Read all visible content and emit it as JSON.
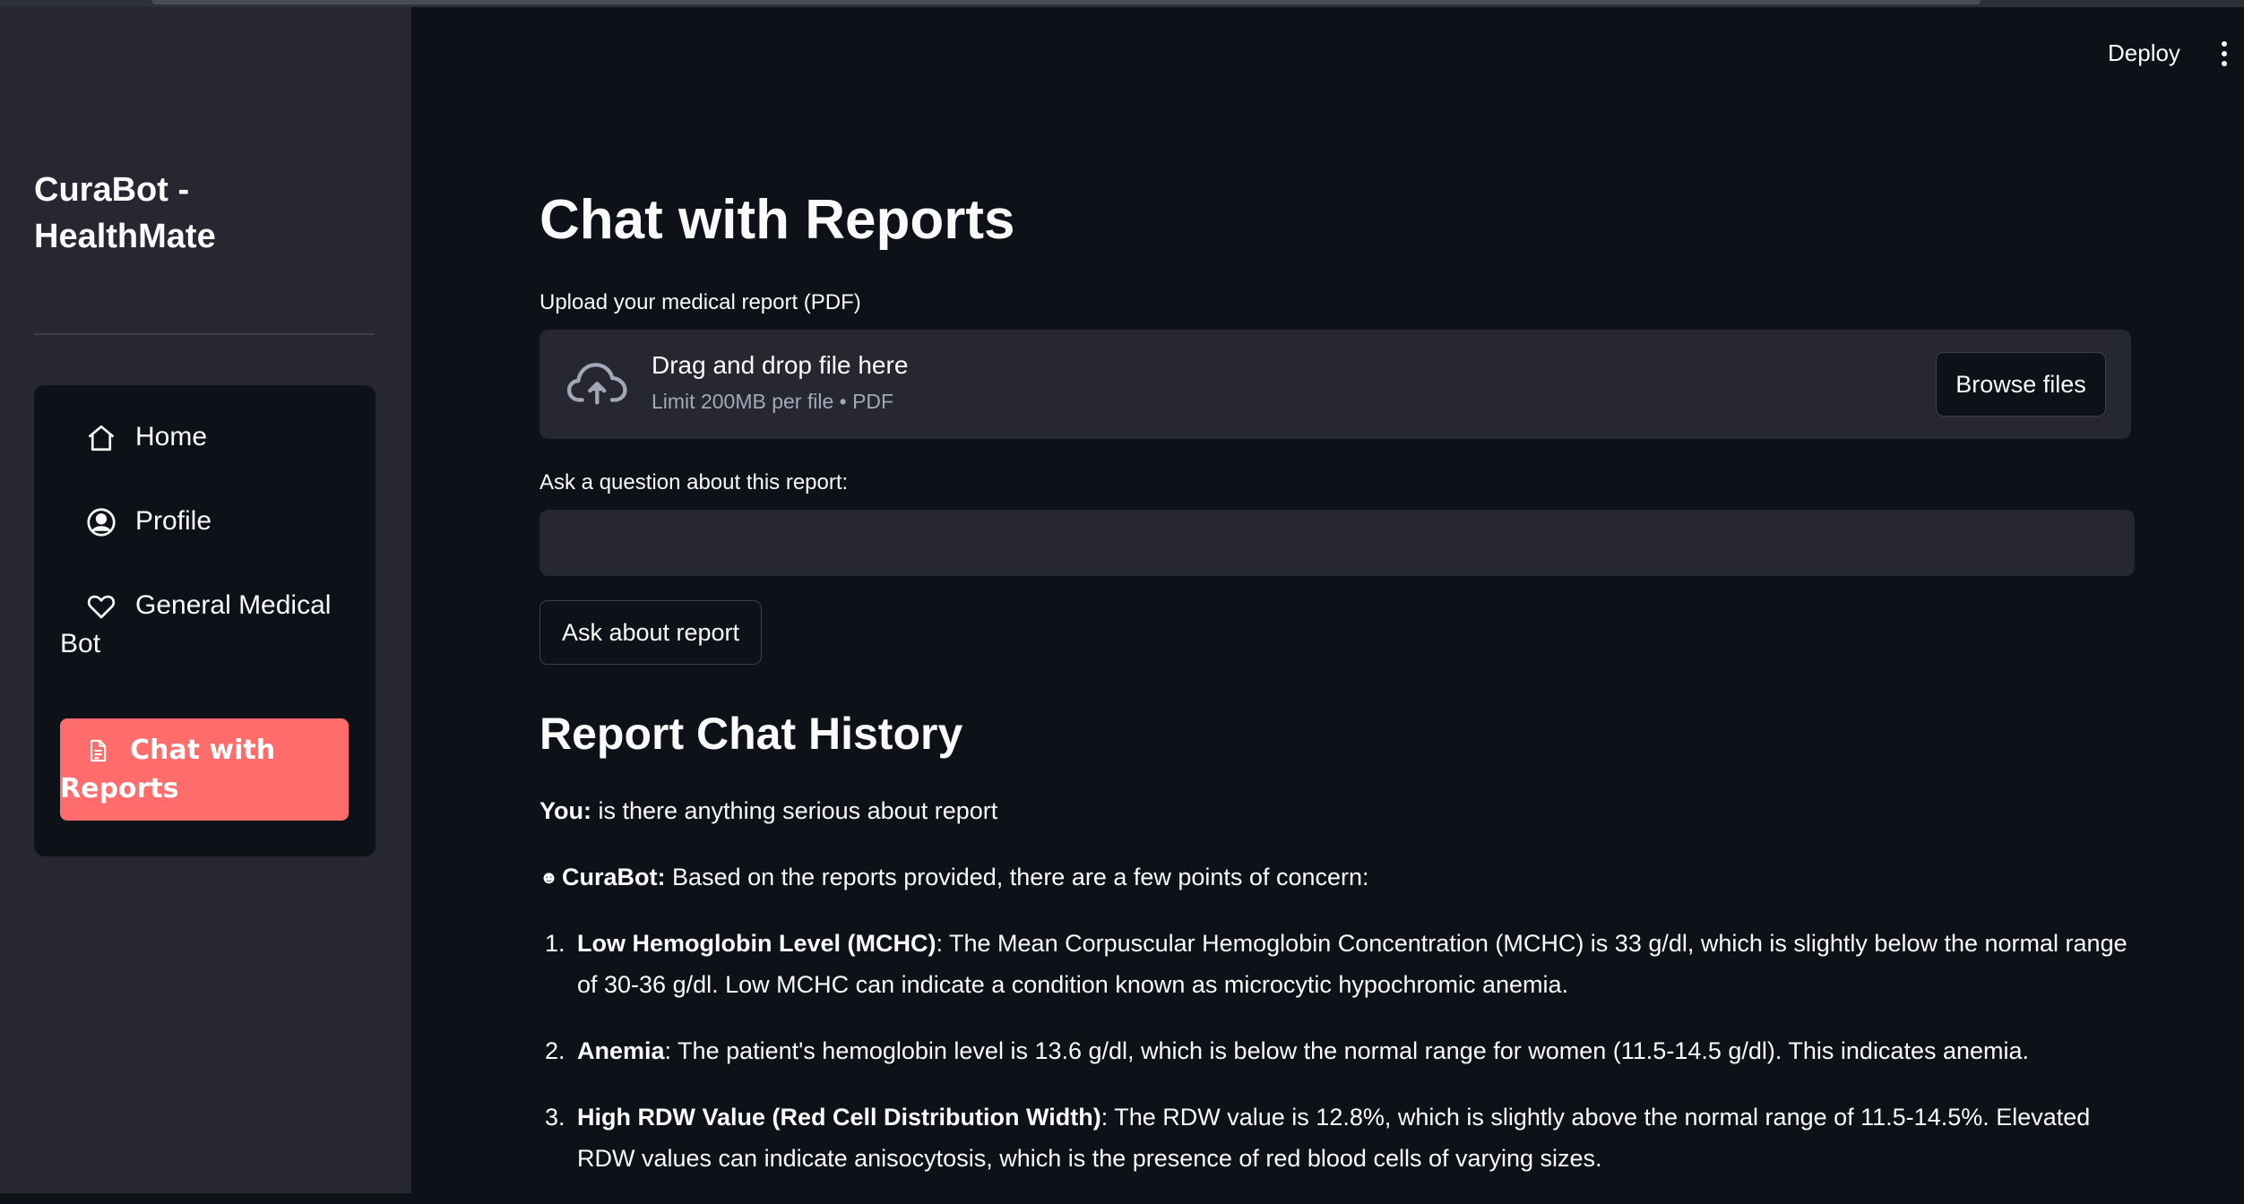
{
  "sidebar": {
    "brand": "CuraBot - HealthMate",
    "items": [
      {
        "label": "Home",
        "icon": "home-icon",
        "active": false
      },
      {
        "label": "Profile",
        "icon": "user-circle-icon",
        "active": false
      },
      {
        "label": "General Medical Bot",
        "icon": "heart-icon",
        "active": true
      },
      {
        "label": "Chat with Reports",
        "icon": "document-icon",
        "active": true
      }
    ]
  },
  "header": {
    "deploy_label": "Deploy",
    "menu_icon": "kebab-menu-icon"
  },
  "main": {
    "title": "Chat with Reports",
    "upload": {
      "label": "Upload your medical report (PDF)",
      "drop_text": "Drag and drop file here",
      "limit_text": "Limit 200MB per file • PDF",
      "browse_label": "Browse files",
      "icon": "cloud-upload-icon"
    },
    "question": {
      "label": "Ask a question about this report:",
      "value": ""
    },
    "ask_button": "Ask about report",
    "history": {
      "title": "Report Chat History",
      "user_prefix": "You:",
      "user_message": " is there anything serious about report",
      "bot_icon": "bot-emoji-icon",
      "bot_prefix": "CuraBot:",
      "bot_message": " Based on the reports provided, there are a few points of concern:",
      "points": [
        {
          "num": "1.",
          "heading": "Low Hemoglobin Level (MCHC)",
          "text": ": The Mean Corpuscular Hemoglobin Concentration (MCHC) is 33 g/dl, which is slightly below the normal range of 30-36 g/dl. Low MCHC can indicate a condition known as microcytic hypochromic anemia."
        },
        {
          "num": "2.",
          "heading": "Anemia",
          "text": ": The patient's hemoglobin level is 13.6 g/dl, which is below the normal range for women (11.5-14.5 g/dl). This indicates anemia."
        },
        {
          "num": "3.",
          "heading": "High RDW Value (Red Cell Distribution Width)",
          "text": ": The RDW value is 12.8%, which is slightly above the normal range of 11.5-14.5%. Elevated RDW values can indicate anisocytosis, which is the presence of red blood cells of varying sizes."
        }
      ]
    }
  },
  "colors": {
    "background": "#0e1117",
    "sidebar": "#262730",
    "accent": "#ff6c6c"
  }
}
